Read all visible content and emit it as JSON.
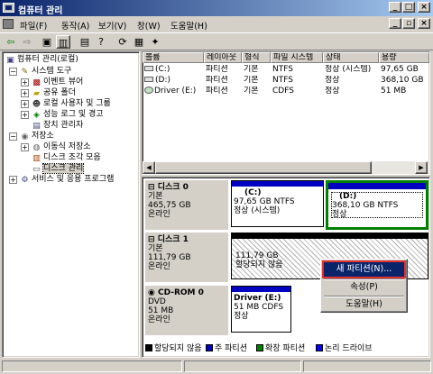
{
  "window": {
    "title": "컴퓨터 관리"
  },
  "menu": {
    "items": [
      "파일(F)",
      "동작(A)",
      "보기(V)",
      "창(W)",
      "도움말(H)"
    ]
  },
  "tree": {
    "items": [
      {
        "label": "컴퓨터 관리(로컬)",
        "icon": "computer-icon"
      },
      {
        "label": "시스템 도구",
        "icon": "tools-icon"
      },
      {
        "label": "이벤트 뷰어",
        "icon": "event-viewer-icon"
      },
      {
        "label": "공유 폴더",
        "icon": "shared-folder-icon"
      },
      {
        "label": "로컬 사용자 및 그룹",
        "icon": "users-icon"
      },
      {
        "label": "성능 로그 및 경고",
        "icon": "performance-icon"
      },
      {
        "label": "장치 관리자",
        "icon": "device-manager-icon"
      },
      {
        "label": "저장소",
        "icon": "storage-icon"
      },
      {
        "label": "이동식 저장소",
        "icon": "removable-storage-icon"
      },
      {
        "label": "디스크 조각 모음",
        "icon": "defrag-icon"
      },
      {
        "label": "디스크 관리",
        "icon": "disk-management-icon"
      },
      {
        "label": "서비스 및 응용 프로그램",
        "icon": "services-icon"
      }
    ]
  },
  "volumes": {
    "columns": [
      "볼륨",
      "레이아웃",
      "형식",
      "파일 시스템",
      "상태",
      "용량"
    ],
    "rows": [
      {
        "volume": "(C:)",
        "layout": "파티션",
        "type": "기본",
        "fs": "NTFS",
        "status": "정상 (시스템)",
        "capacity": "97,65 GB"
      },
      {
        "volume": "(D:)",
        "layout": "파티션",
        "type": "기본",
        "fs": "NTFS",
        "status": "정상",
        "capacity": "368,10 GB"
      },
      {
        "volume": "Driver (E:)",
        "layout": "파티션",
        "type": "기본",
        "fs": "CDFS",
        "status": "정상",
        "capacity": "51 MB"
      }
    ]
  },
  "disks": {
    "disk0": {
      "title": "디스크 0",
      "kind": "기본",
      "size": "465,75 GB",
      "state": "온라인",
      "p1": {
        "name": "(C:)",
        "info": "97,65 GB NTFS",
        "status": "정상 (시스템)"
      },
      "p2": {
        "name": "(D:)",
        "info": "368,10 GB NTFS",
        "status": "정상"
      }
    },
    "disk1": {
      "title": "디스크 1",
      "kind": "기본",
      "size": "111,79 GB",
      "state": "온라인",
      "p1": {
        "size": "111,79 GB",
        "status": "할당되지 않음"
      }
    },
    "cdrom0": {
      "title": "CD-ROM 0",
      "kind": "DVD",
      "size": "51 MB",
      "state": "온라인",
      "p1": {
        "name": "Driver (E:)",
        "info": "51 MB CDFS",
        "status": "정상"
      }
    }
  },
  "legend": [
    {
      "label": "할당되지 않음",
      "color": "#000000"
    },
    {
      "label": "주 파티션",
      "color": "#0000c0"
    },
    {
      "label": "확장 파티션",
      "color": "#008000"
    },
    {
      "label": "논리 드라이브",
      "color": "#0000ff"
    }
  ],
  "context_menu": {
    "items": [
      "새 파티션(N)...",
      "속성(P)",
      "도움말(H)"
    ]
  },
  "colors": {
    "titlebar": "#0a246a",
    "primary": "#0000c0",
    "selected_border": "#008000",
    "highlight_outline": "#e03030"
  }
}
